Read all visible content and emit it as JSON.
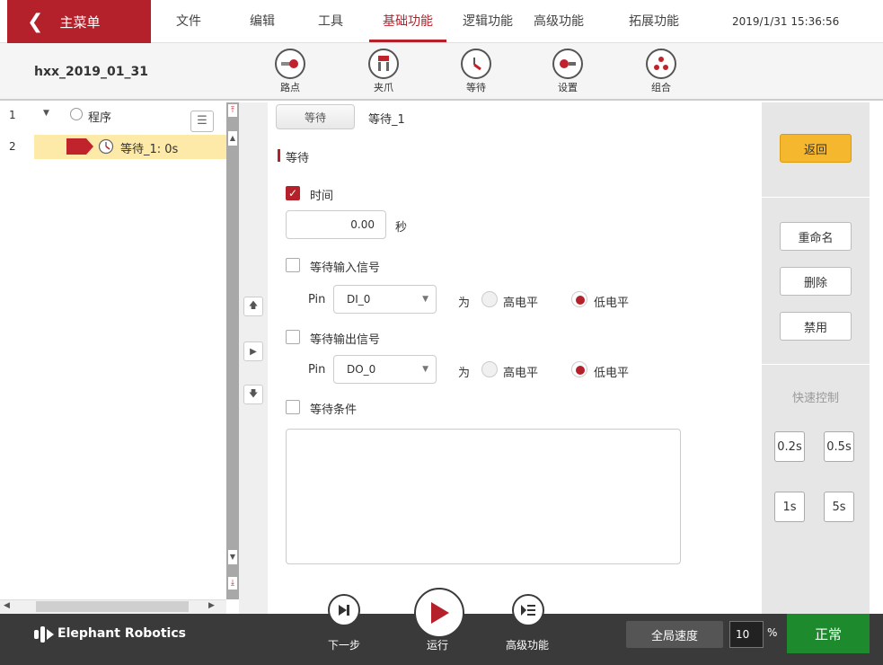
{
  "header": {
    "main_menu": "主菜单",
    "menus": [
      "文件",
      "编辑",
      "工具",
      "基础功能",
      "逻辑功能",
      "高级功能",
      "拓展功能"
    ],
    "active_menu": "基础功能",
    "datetime": "2019/1/31 15:36:56",
    "accent_color": "#b5212b"
  },
  "toolbar": {
    "program_name": "hxx_2019_01_31",
    "tools": [
      {
        "label": "路点",
        "icon": "waypoint-icon"
      },
      {
        "label": "夹爪",
        "icon": "gripper-icon"
      },
      {
        "label": "等待",
        "icon": "wait-clock-icon"
      },
      {
        "label": "设置",
        "icon": "settings-icon"
      },
      {
        "label": "组合",
        "icon": "combine-icon"
      }
    ]
  },
  "tree": {
    "rows": [
      {
        "num": "1",
        "label": "程序"
      },
      {
        "num": "2",
        "label": "等待_1: 0s"
      }
    ]
  },
  "editor": {
    "tab_label": "等待",
    "node_name": "等待_1",
    "section_title": "等待",
    "time_label": "时间",
    "time_value": "0.00",
    "time_unit": "秒",
    "wait_input_label": "等待输入信号",
    "wait_output_label": "等待输出信号",
    "wait_condition_label": "等待条件",
    "pin_label": "Pin",
    "input_pin": "DI_0",
    "output_pin": "DO_0",
    "as_label": "为",
    "high_label": "高电平",
    "low_label": "低电平"
  },
  "side": {
    "back": "返回",
    "rename": "重命名",
    "delete": "删除",
    "disable": "禁用",
    "quick_control": "快速控制",
    "quick": [
      "0.2s",
      "0.5s",
      "1s",
      "5s"
    ]
  },
  "footer": {
    "brand": "Elephant Robotics",
    "step": "下一步",
    "run": "运行",
    "advanced": "高级功能",
    "speed_label": "全局速度",
    "speed_value": "10",
    "percent": "%",
    "status": "正常",
    "status_color": "#1e8a2e"
  }
}
